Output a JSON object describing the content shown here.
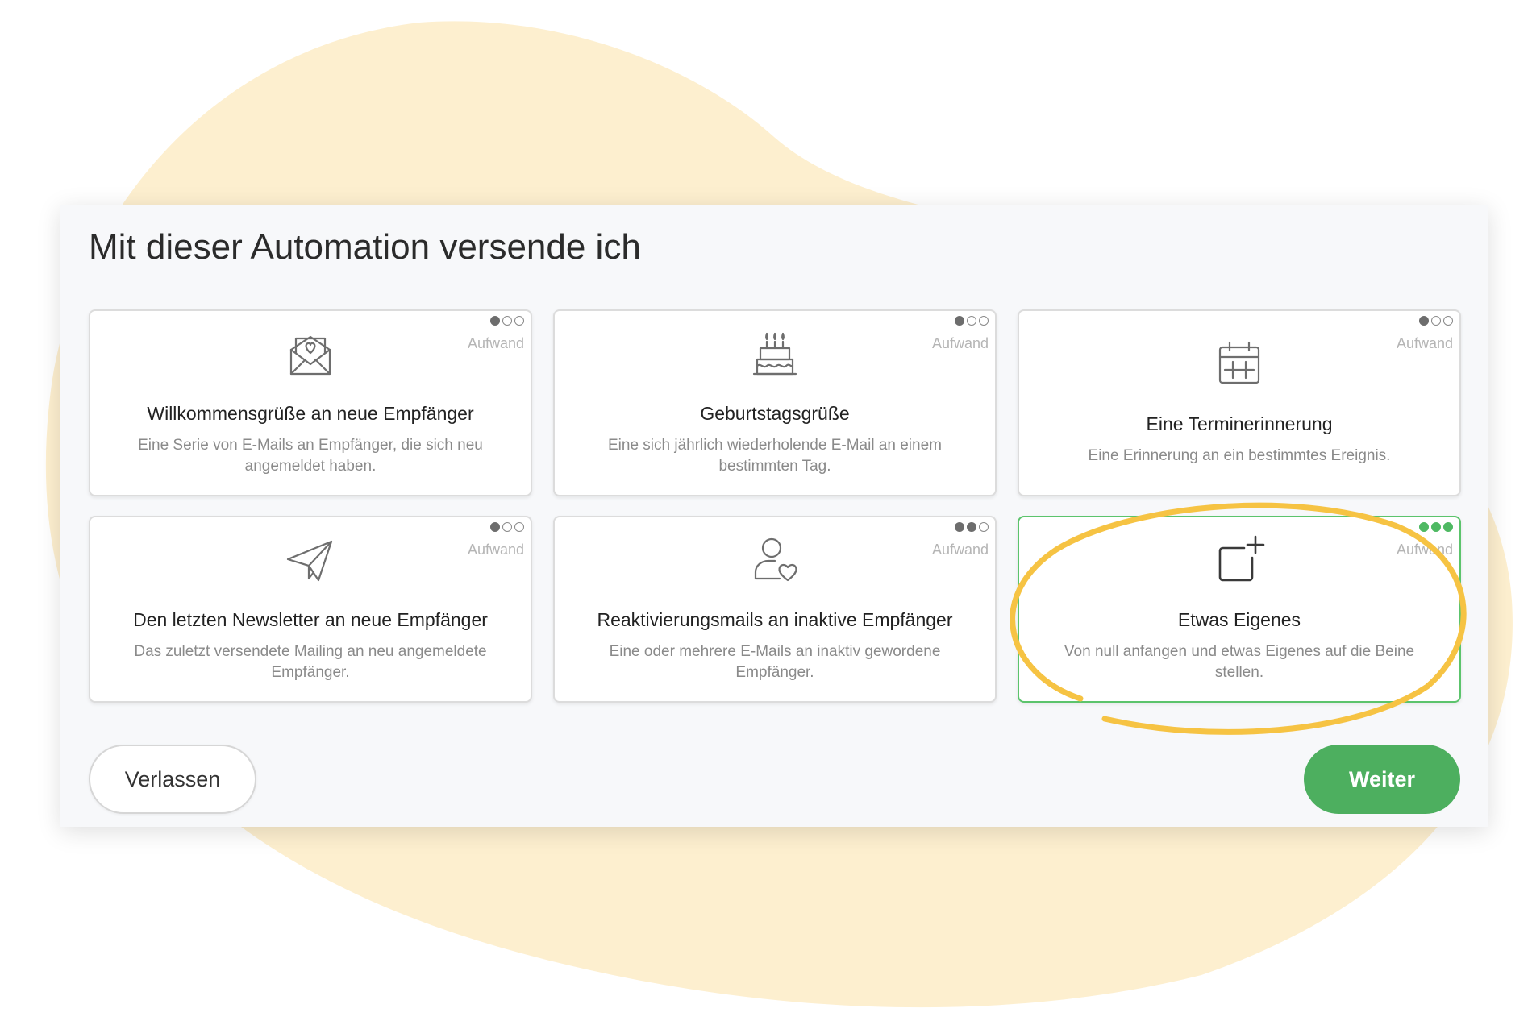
{
  "colors": {
    "background_blob": "#fdefcf",
    "accent_green": "#4daf5f",
    "highlight_circle": "#f6c343",
    "card_border_selected": "#5cc46c"
  },
  "dialog": {
    "title": "Mit dieser Automation versende ich",
    "effort_label": "Aufwand",
    "cards": [
      {
        "icon": "envelope-heart-icon",
        "title": "Willkommensgrüße an neue Empfänger",
        "description": "Eine Serie von E-Mails an Empfänger, die sich neu angemeldet haben.",
        "effort_level": 1,
        "selected": false
      },
      {
        "icon": "birthday-cake-icon",
        "title": "Geburtstagsgrüße",
        "description": "Eine sich jährlich wiederholende E-Mail an einem bestimmten Tag.",
        "effort_level": 1,
        "selected": false
      },
      {
        "icon": "calendar-icon",
        "title": "Eine Terminerinnerung",
        "description": "Eine Erinnerung an ein bestimmtes Ereignis.",
        "effort_level": 1,
        "selected": false
      },
      {
        "icon": "paper-plane-icon",
        "title": "Den letzten Newsletter an neue Empfänger",
        "description": "Das zuletzt versendete Mailing an neu angemeldete Empfänger.",
        "effort_level": 1,
        "selected": false
      },
      {
        "icon": "user-heart-icon",
        "title": "Reaktivierungsmails an inaktive Empfänger",
        "description": "Eine oder mehrere E-Mails an inaktiv gewordene Empfänger.",
        "effort_level": 2,
        "selected": false
      },
      {
        "icon": "square-plus-icon",
        "title": "Etwas Eigenes",
        "description": "Von null anfangen und etwas Eigenes auf die Beine stellen.",
        "effort_level": 3,
        "selected": true
      }
    ],
    "buttons": {
      "leave": "Verlassen",
      "next": "Weiter"
    }
  }
}
